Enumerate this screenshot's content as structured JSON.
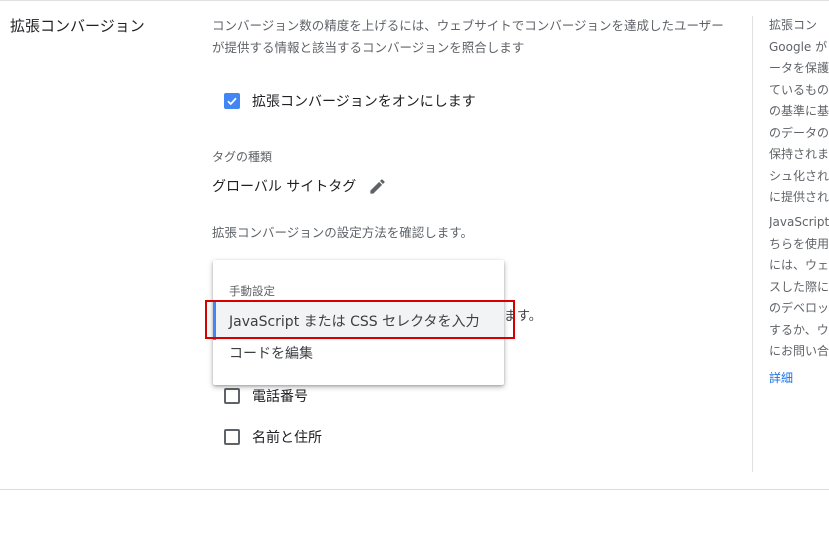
{
  "section": {
    "title": "拡張コンバージョン",
    "description": "コンバージョン数の精度を上げるには、ウェブサイトでコンバージョンを達成したユーザーが提供する情報と該当するコンバージョンを照合します"
  },
  "enable_checkbox": {
    "label": "拡張コンバージョンをオンにします",
    "checked": true
  },
  "tag": {
    "label": "タグの種類",
    "value": "グローバル サイトタグ",
    "edit_icon": "pencil-icon"
  },
  "setup_text": "拡張コンバージョンの設定方法を確認します。",
  "hidden_text_suffix": "ます。",
  "dropdown_menu": {
    "header": "手動設定",
    "items": [
      {
        "label": "JavaScript または CSS セレクタを入力",
        "selected": true
      },
      {
        "label": "コードを編集",
        "selected": false
      }
    ]
  },
  "field_checkboxes": [
    {
      "label": "電話番号",
      "checked": false
    },
    {
      "label": "名前と住所",
      "checked": false
    }
  ],
  "side_panel": {
    "paragraph1": [
      "拡張コン",
      "Google が",
      "ータを保護",
      "ているもの",
      "の基準に基",
      "のデータの",
      "保持されま",
      "シュ化され",
      "に提供され"
    ],
    "paragraph2": [
      "JavaScript",
      "ちらを使用",
      "には、ウェ",
      "スした際に",
      "のデベロッ",
      "するか、ウ",
      "にお問い合"
    ],
    "link": "詳細"
  },
  "colors": {
    "accent": "#4285f4",
    "highlight": "#d50000",
    "link": "#1a73e8"
  }
}
